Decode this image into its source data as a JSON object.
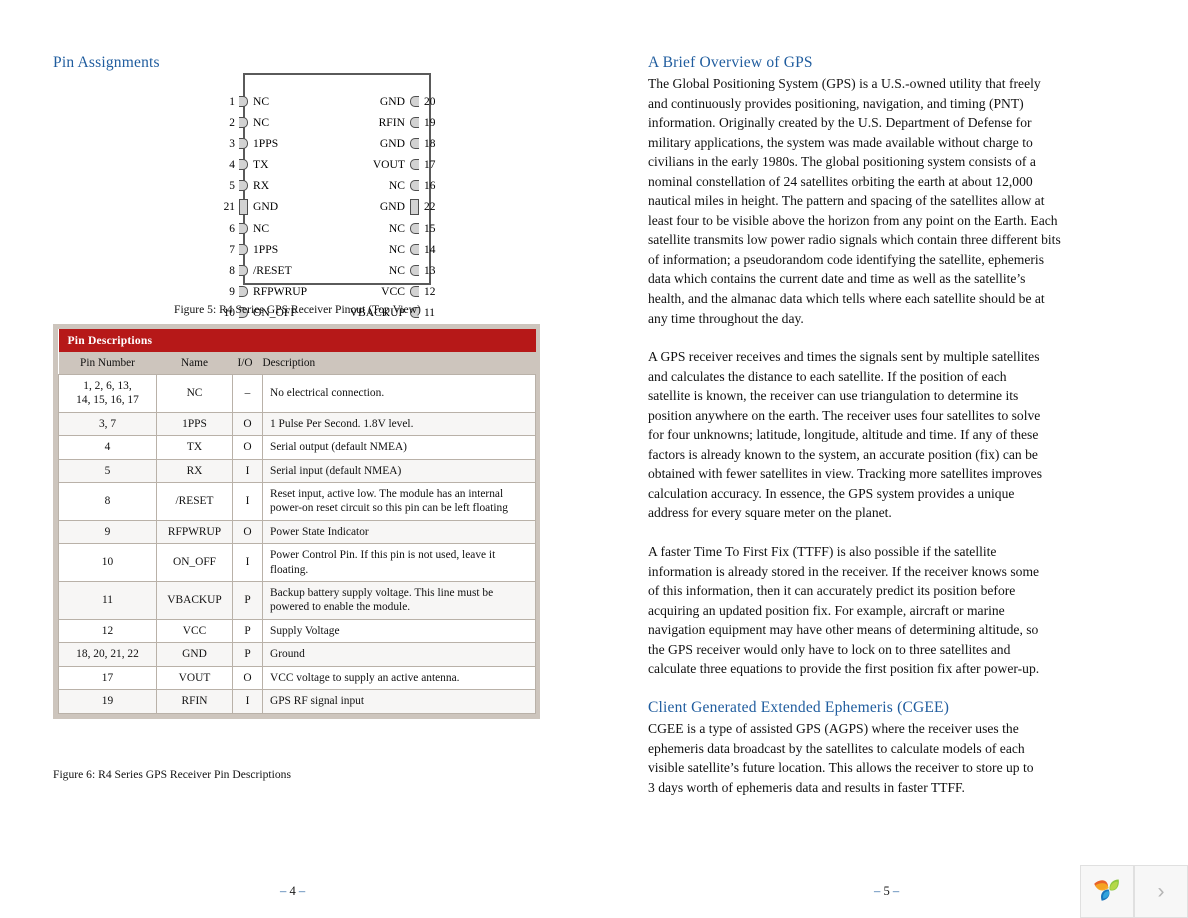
{
  "left_column": {
    "pin_assignments_heading": "Pin Assignments",
    "pin_descriptions_heading": "Pin Descriptions",
    "figure5_caption": "Figure 5: R4 Series GPS Receiver Pinout (Top View)",
    "figure6_caption": "Figure 6: R4 Series GPS Receiver Pin Descriptions",
    "diagram": {
      "rows": [
        {
          "left_num": "1",
          "left_label": "NC",
          "right_label": "GND",
          "right_num": "20",
          "tall": false
        },
        {
          "left_num": "2",
          "left_label": "NC",
          "right_label": "RFIN",
          "right_num": "19",
          "tall": false
        },
        {
          "left_num": "3",
          "left_label": "1PPS",
          "right_label": "GND",
          "right_num": "18",
          "tall": false
        },
        {
          "left_num": "4",
          "left_label": "TX",
          "right_label": "VOUT",
          "right_num": "17",
          "tall": false
        },
        {
          "left_num": "5",
          "left_label": "RX",
          "right_label": "NC",
          "right_num": "16",
          "tall": false
        },
        {
          "left_num": "21",
          "left_label": "GND",
          "right_label": "GND",
          "right_num": "22",
          "tall": true
        },
        {
          "left_num": "6",
          "left_label": "NC",
          "right_label": "NC",
          "right_num": "15",
          "tall": false
        },
        {
          "left_num": "7",
          "left_label": "1PPS",
          "right_label": "NC",
          "right_num": "14",
          "tall": false
        },
        {
          "left_num": "8",
          "left_label": "/RESET",
          "right_label": "NC",
          "right_num": "13",
          "tall": false
        },
        {
          "left_num": "9",
          "left_label": "RFPWRUP",
          "right_label": "VCC",
          "right_num": "12",
          "tall": false
        },
        {
          "left_num": "10",
          "left_label": "ON_OFF",
          "right_label": "VBACKUP",
          "right_num": "11",
          "tall": false
        }
      ]
    },
    "table": {
      "title": "Pin Descriptions",
      "columns": [
        "Pin Number",
        "Name",
        "I/O",
        "Description"
      ],
      "rows": [
        {
          "pin": "1, 2, 6, 13,\n14, 15, 16, 17",
          "name": "NC",
          "io": "–",
          "desc": "No electrical connection."
        },
        {
          "pin": "3, 7",
          "name": "1PPS",
          "io": "O",
          "desc": "1 Pulse Per Second. 1.8V level."
        },
        {
          "pin": "4",
          "name": "TX",
          "io": "O",
          "desc": "Serial output (default NMEA)"
        },
        {
          "pin": "5",
          "name": "RX",
          "io": "I",
          "desc": "Serial input (default NMEA)"
        },
        {
          "pin": "8",
          "name": "/RESET",
          "io": "I",
          "desc": "Reset input, active low. The module has an internal power-on reset circuit so this pin can be left floating"
        },
        {
          "pin": "9",
          "name": "RFPWRUP",
          "io": "O",
          "desc": "Power State Indicator"
        },
        {
          "pin": "10",
          "name": "ON_OFF",
          "io": "I",
          "desc": "Power Control Pin. If this pin is not used, leave it floating."
        },
        {
          "pin": "11",
          "name": "VBACKUP",
          "io": "P",
          "desc": "Backup battery supply voltage. This line must be powered to enable the module."
        },
        {
          "pin": "12",
          "name": "VCC",
          "io": "P",
          "desc": "Supply Voltage"
        },
        {
          "pin": "18, 20, 21, 22",
          "name": "GND",
          "io": "P",
          "desc": "Ground"
        },
        {
          "pin": "17",
          "name": "VOUT",
          "io": "O",
          "desc": "VCC voltage to supply an active antenna."
        },
        {
          "pin": "19",
          "name": "RFIN",
          "io": "I",
          "desc": "GPS RF signal input"
        }
      ]
    }
  },
  "right_column": {
    "gps_heading": "A Brief Overview of GPS",
    "gps_paragraph_1": "The Global Positioning System (GPS) is a U.S.-owned utility that freely and continuously provides positioning, navigation, and timing (PNT) information. Originally created by the U.S. Department of Defense for military applications, the system was made available without charge to civilians in the early 1980s. The global positioning system consists of a nominal constellation of 24 satellites orbiting the earth at about 12,000 nautical miles in height. The pattern and spacing of the satellites allow at least four to be visible above the horizon from any point on the Earth. Each satellite transmits low power radio signals which contain three different bits of information; a pseudorandom code identifying the satellite, ephemeris data which contains the current date and time as well as the satellite’s health, and the almanac data which tells where each satellite should be at any time throughout the day.",
    "gps_paragraph_2": "A GPS receiver receives and times the signals sent by multiple satellites and calculates the distance to each satellite. If the position of each satellite is known, the receiver can use triangulation to determine its position anywhere on the earth. The receiver uses four satellites to solve for four unknowns; latitude, longitude, altitude and time. If any of these factors is already known to the system, an accurate position (fix) can be obtained with fewer satellites in view. Tracking more satellites improves calculation accuracy. In essence, the GPS system provides a unique address for every square meter on the planet.",
    "gps_paragraph_3": "A faster Time To First Fix (TTFF) is also possible if the satellite information is already stored in the receiver. If the receiver knows some of this information, then it can accurately predict its position before acquiring an updated position fix. For example, aircraft or marine navigation equipment may have other means of determining altitude, so the GPS receiver would only have to lock on to three satellites and calculate three equations to provide the first position fix after power-up.",
    "cgee_heading": "Client Generated Extended Ephemeris (CGEE)",
    "cgee_paragraph": "CGEE is a type of assisted GPS (AGPS) where the receiver uses the ephemeris data broadcast by the satellites to calculate models of each visible satellite’s future location. This allows the receiver to store up to 3 days worth of ephemeris data and results in faster TTFF."
  },
  "footer": {
    "left_page_dash_before": "–",
    "left_page_number": "4",
    "left_page_dash_after": "–",
    "right_page_dash_before": "–",
    "right_page_number": "5",
    "right_page_dash_after": "–"
  },
  "widget": {
    "logo_icon": "three-petal-leaf-logo",
    "next_icon": "chevron-right-icon",
    "next_glyph": "›"
  },
  "colors": {
    "heading_blue": "#1F5C9E",
    "table_header_red": "#B61818",
    "table_frame_tan": "#cdc5bd",
    "logo_orange": "#E8622A",
    "logo_green": "#8CC63F",
    "logo_blue": "#1B75BB"
  }
}
